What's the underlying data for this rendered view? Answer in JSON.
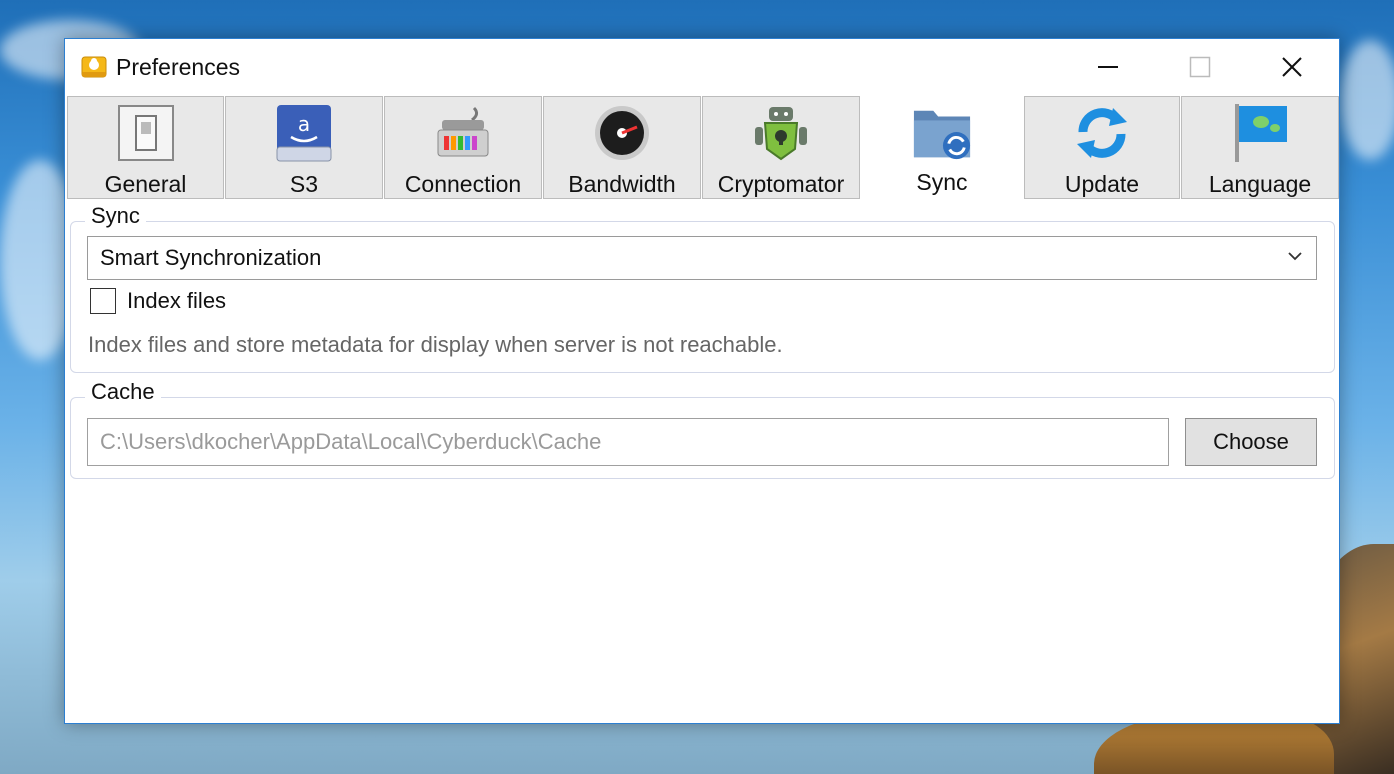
{
  "window": {
    "title": "Preferences"
  },
  "tabs": [
    {
      "label": "General",
      "icon": "switch-icon",
      "active": false
    },
    {
      "label": "S3",
      "icon": "amazon-drive-icon",
      "active": false
    },
    {
      "label": "Connection",
      "icon": "network-connector-icon",
      "active": false
    },
    {
      "label": "Bandwidth",
      "icon": "speedometer-icon",
      "active": false
    },
    {
      "label": "Cryptomator",
      "icon": "cryptomator-robot-icon",
      "active": false
    },
    {
      "label": "Sync",
      "icon": "sync-folder-icon",
      "active": true
    },
    {
      "label": "Update",
      "icon": "refresh-arrows-icon",
      "active": false
    },
    {
      "label": "Language",
      "icon": "flag-globe-icon",
      "active": false
    }
  ],
  "sync_group": {
    "legend": "Sync",
    "mode_selected": "Smart Synchronization",
    "index_files_label": "Index files",
    "index_files_checked": false,
    "description": "Index files and store metadata for display when server is not reachable."
  },
  "cache_group": {
    "legend": "Cache",
    "path": "C:\\Users\\dkocher\\AppData\\Local\\Cyberduck\\Cache",
    "choose_label": "Choose"
  },
  "colors": {
    "window_border": "#2c7fd1",
    "tab_inactive": "#e8e8e8",
    "group_border": "#d3d8e8"
  }
}
